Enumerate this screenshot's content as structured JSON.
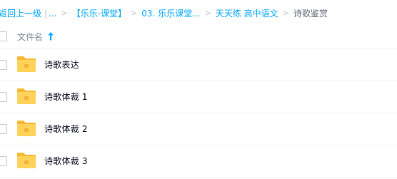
{
  "breadcrumb": {
    "back_label": "返回上一级",
    "ellipsis": "...",
    "items": [
      "【乐乐-课堂】",
      "03. 乐乐课堂...",
      "天天练 高中语文"
    ],
    "current": "诗歌鉴赏"
  },
  "header": {
    "filename_label": "文件名"
  },
  "files": [
    {
      "name": "诗歌表达",
      "icon": "folder-icon"
    },
    {
      "name": "诗歌体裁 1",
      "icon": "folder-icon"
    },
    {
      "name": "诗歌体裁 2",
      "icon": "folder-icon"
    },
    {
      "name": "诗歌体裁 3",
      "icon": "folder-icon"
    }
  ],
  "colors": {
    "accent": "#09aaff",
    "folder": "#ffd35b"
  }
}
